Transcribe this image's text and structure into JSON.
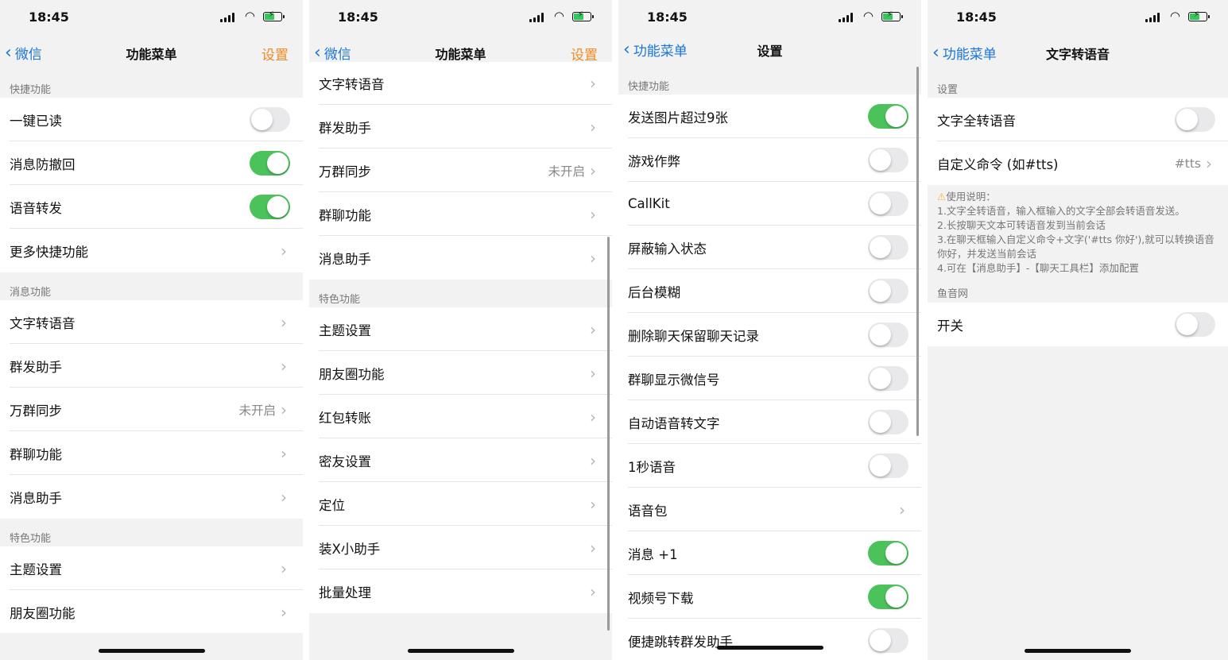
{
  "status_time": "18:45",
  "p1": {
    "back": "微信",
    "title": "功能菜单",
    "right": "设置",
    "sec1": "快捷功能",
    "r1": "一键已读",
    "r2": "消息防撤回",
    "r3": "语音转发",
    "r4": "更多快捷功能",
    "sec2": "消息功能",
    "r5": "文字转语音",
    "r6": "群发助手",
    "r7": "万群同步",
    "r7v": "未开启",
    "r8": "群聊功能",
    "r9": "消息助手",
    "sec3": "特色功能",
    "r10": "主题设置",
    "r11": "朋友圈功能",
    "toggles": {
      "r1": false,
      "r2": true,
      "r3": true
    }
  },
  "p2": {
    "back": "微信",
    "title": "功能菜单",
    "right": "设置",
    "r1": "文字转语音",
    "r2": "群发助手",
    "r3": "万群同步",
    "r3v": "未开启",
    "r4": "群聊功能",
    "r5": "消息助手",
    "sec": "特色功能",
    "r6": "主题设置",
    "r7": "朋友圈功能",
    "r8": "红包转账",
    "r9": "密友设置",
    "r10": "定位",
    "r11": "装X小助手",
    "r12": "批量处理"
  },
  "p3": {
    "back": "功能菜单",
    "title": "设置",
    "sec": "快捷功能",
    "r1": "发送图片超过9张",
    "r2": "游戏作弊",
    "r3": "CallKit",
    "r4": "屏蔽输入状态",
    "r5": "后台模糊",
    "r6": "删除聊天保留聊天记录",
    "r7": "群聊显示微信号",
    "r8": "自动语音转文字",
    "r9": "1秒语音",
    "r10": "语音包",
    "r11": "消息 +1",
    "r12": "视频号下载",
    "r13": "便捷跳转群发助手",
    "toggles": {
      "r1": true,
      "r2": false,
      "r3": false,
      "r4": false,
      "r5": false,
      "r6": false,
      "r7": false,
      "r8": false,
      "r9": false,
      "r11": true,
      "r12": true,
      "r13": false
    }
  },
  "p4": {
    "back": "功能菜单",
    "title": "文字转语音",
    "sec1": "设置",
    "r1": "文字全转语音",
    "r2": "自定义命令 (如#tts)",
    "r2v": "#tts",
    "note_title": "使用说明：",
    "note1": "1.文字全转语音，输入框输入的文字全部会转语音发送。",
    "note2": "2.长按聊天文本可转语音发到当前会话",
    "note3": "3.在聊天框输入自定义命令+文字('#tts 你好'),就可以转换语音你好，并发送当前会话",
    "note4": "4.可在【消息助手】-【聊天工具栏】添加配置",
    "sec2": "鱼音网",
    "r3": "开关",
    "toggles": {
      "r1": false,
      "r3": false
    }
  },
  "colors": {
    "link_blue": "#1b74d8",
    "orange": "#f08a24",
    "toggle_on": "#4cc25b",
    "background": "#f2f2f2"
  }
}
